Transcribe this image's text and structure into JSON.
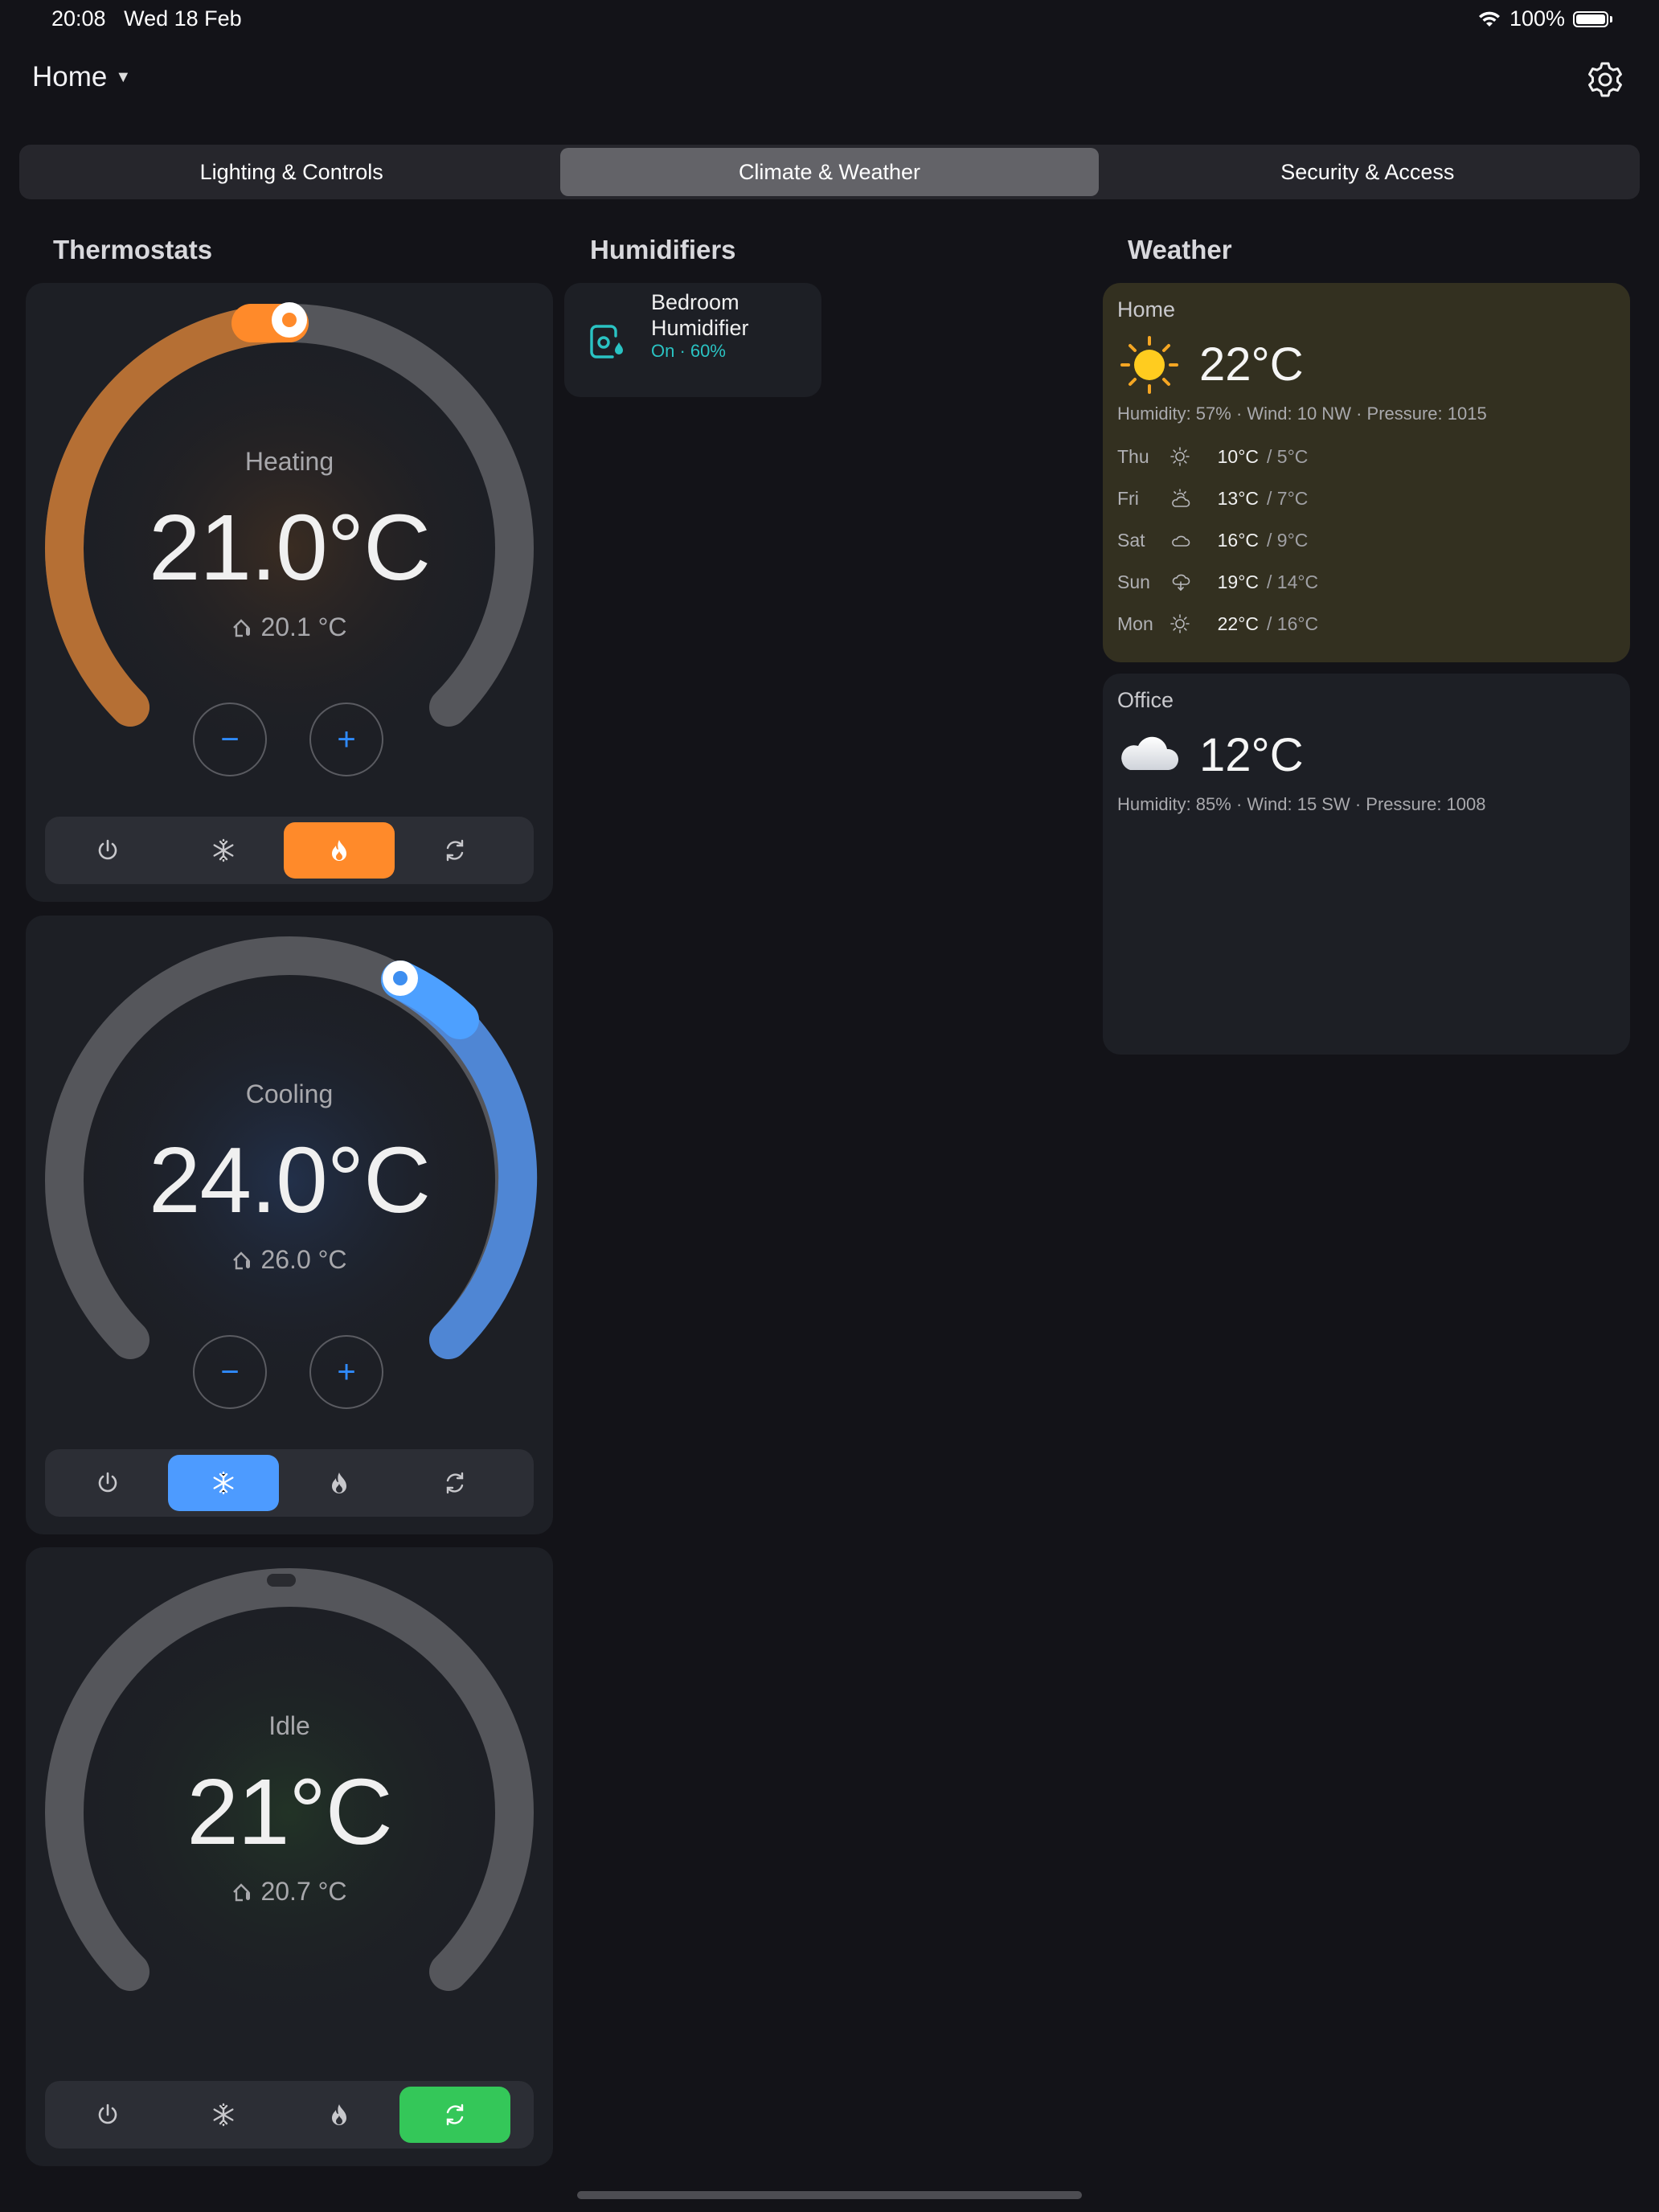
{
  "status_bar": {
    "time": "20:08",
    "date": "Wed 18 Feb",
    "battery": "100%"
  },
  "header": {
    "title": "Home",
    "settings_icon": "gear-icon"
  },
  "tabs": [
    {
      "label": "Lighting & Controls",
      "active": false
    },
    {
      "label": "Climate & Weather",
      "active": true
    },
    {
      "label": "Security & Access",
      "active": false
    }
  ],
  "sections": {
    "thermostats": "Thermostats",
    "humidifiers": "Humidifiers",
    "weather": "Weather"
  },
  "thermostats": [
    {
      "mode": "Heating",
      "target": "21.0°C",
      "current": "20.1 °C",
      "active_mode": "heat",
      "accent": "#ff8a2a",
      "minus": "−",
      "plus": "+"
    },
    {
      "mode": "Cooling",
      "target": "24.0°C",
      "current": "26.0 °C",
      "active_mode": "cool",
      "accent": "#3d8ef0",
      "minus": "−",
      "plus": "+"
    },
    {
      "mode": "Idle",
      "target": "21°C",
      "current": "20.7 °C",
      "active_mode": "auto",
      "accent": "#34c759"
    }
  ],
  "humidifiers": [
    {
      "name": "Bedroom Humidifier",
      "status": "On · 60%",
      "status_color": "#2ac3c3",
      "icon": "humidifier-icon"
    }
  ],
  "weather": [
    {
      "location": "Home",
      "temp": "22°C",
      "icon": "sun-icon",
      "meta": "Humidity: 57%  ·  Wind: 10 NW  ·  Pressure: 1015",
      "forecast": [
        {
          "day": "Thu",
          "icon": "sun-icon",
          "hi": "10°C",
          "lo": "/ 5°C"
        },
        {
          "day": "Fri",
          "icon": "partly-cloudy-icon",
          "hi": "13°C",
          "lo": "/ 7°C"
        },
        {
          "day": "Sat",
          "icon": "cloud-icon",
          "hi": "16°C",
          "lo": "/ 9°C"
        },
        {
          "day": "Sun",
          "icon": "rain-cloud-icon",
          "hi": "19°C",
          "lo": "/ 14°C"
        },
        {
          "day": "Mon",
          "icon": "sun-icon",
          "hi": "22°C",
          "lo": "/ 16°C"
        }
      ]
    },
    {
      "location": "Office",
      "temp": "12°C",
      "icon": "cloud-icon",
      "meta": "Humidity: 85%  ·  Wind: 15 SW  ·  Pressure: 1008",
      "forecast": []
    }
  ]
}
